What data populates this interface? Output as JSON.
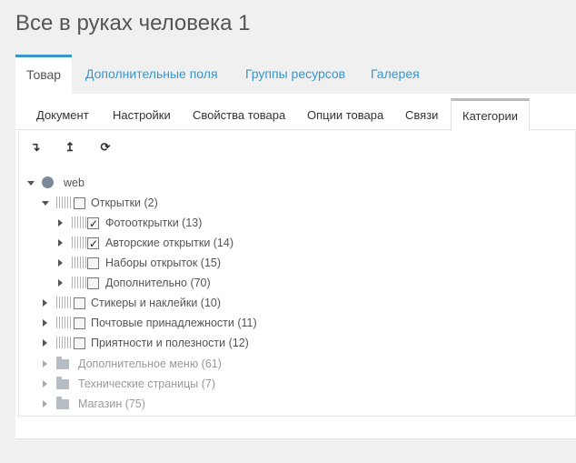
{
  "page": {
    "title": "Все в руках человека 1"
  },
  "top_tabs": [
    {
      "label": "Товар"
    },
    {
      "label": "Дополнительные поля"
    },
    {
      "label": "Группы ресурсов"
    },
    {
      "label": "Галерея"
    }
  ],
  "sub_tabs": [
    {
      "label": "Документ"
    },
    {
      "label": "Настройки"
    },
    {
      "label": "Свойства товара"
    },
    {
      "label": "Опции товара"
    },
    {
      "label": "Связи"
    },
    {
      "label": "Категории"
    }
  ],
  "active_top_tab": "Товар",
  "active_sub_tab": "Категории",
  "toolbar": {
    "expand_icon": "expand-all-icon",
    "collapse_icon": "collapse-all-icon",
    "refresh_icon": "refresh-icon"
  },
  "tree": {
    "root": {
      "label": "web",
      "icon": "globe-icon",
      "expanded": true
    },
    "nodes": [
      {
        "label": "Открытки (2)",
        "checked": false,
        "expanded": true
      },
      {
        "label": "Фотооткрытки (13)",
        "checked": true,
        "expanded": false
      },
      {
        "label": "Авторские открытки (14)",
        "checked": true,
        "expanded": false
      },
      {
        "label": "Наборы открыток (15)",
        "checked": false,
        "expanded": false
      },
      {
        "label": "Дополнительно (70)",
        "checked": false,
        "expanded": false
      },
      {
        "label": "Стикеры и наклейки (10)",
        "checked": false,
        "expanded": false
      },
      {
        "label": "Почтовые принадлежности (11)",
        "checked": false,
        "expanded": false
      },
      {
        "label": "Приятности и полезности (12)",
        "checked": false,
        "expanded": false
      }
    ],
    "contexts": [
      {
        "label": "Дополнительное меню (61)",
        "icon": "folder-icon"
      },
      {
        "label": "Технические страницы (7)",
        "icon": "folder-icon"
      },
      {
        "label": "Магазин (75)",
        "icon": "folder-icon"
      }
    ]
  },
  "colors": {
    "accent": "#3697cd",
    "text": "#555555",
    "muted": "#999999",
    "background": "#f0f0f0"
  }
}
